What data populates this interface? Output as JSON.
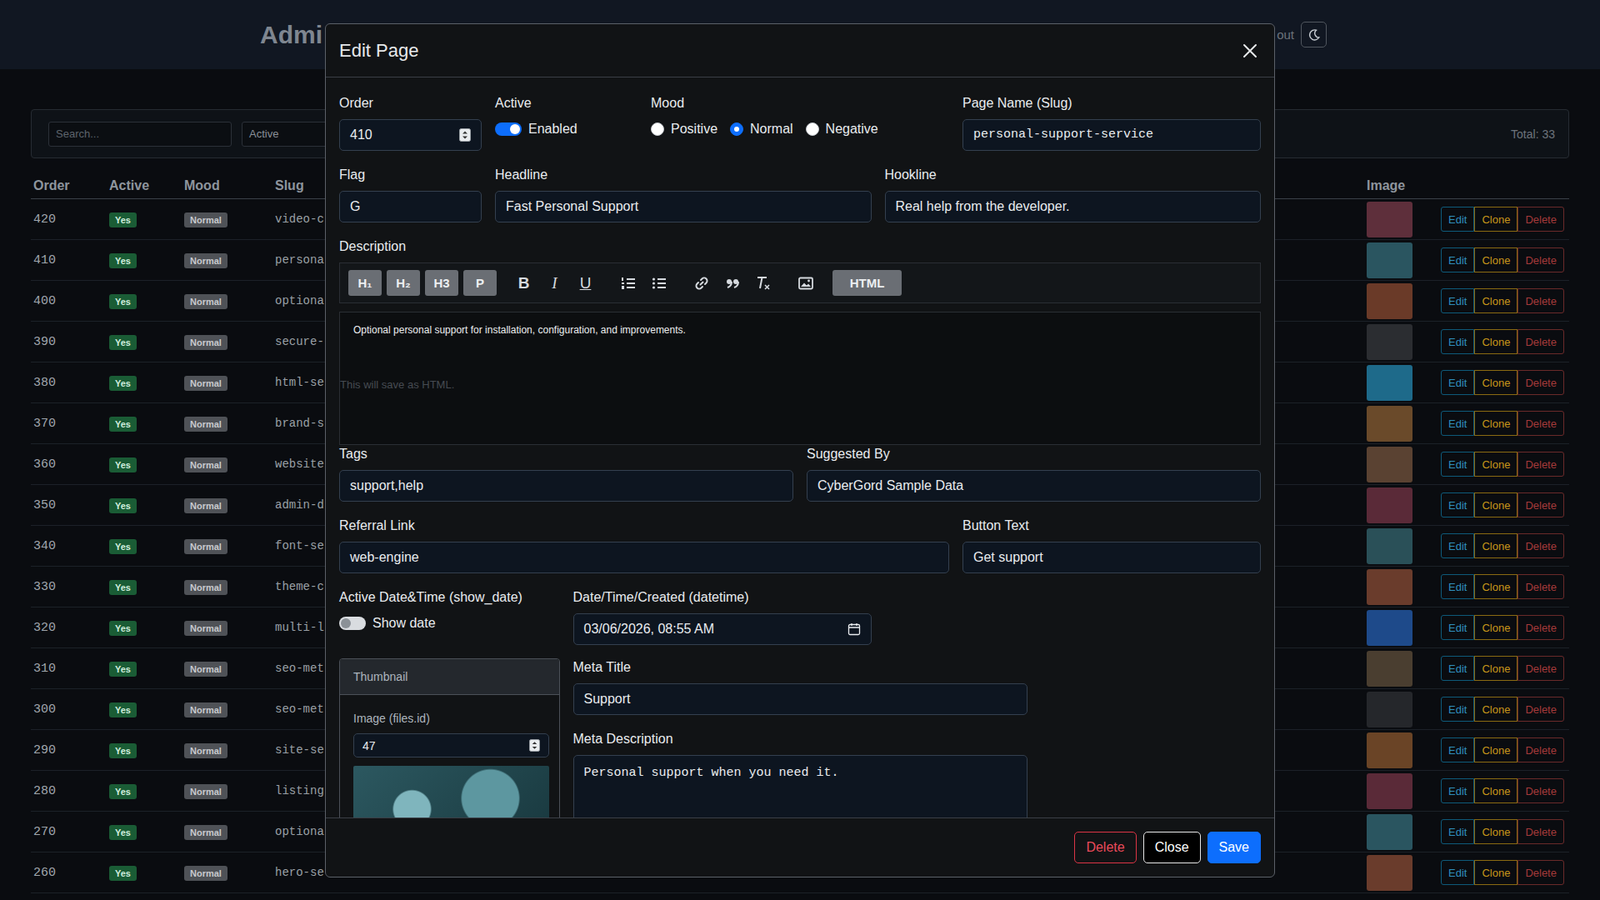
{
  "page": {
    "title": "Admi",
    "logout": "out"
  },
  "filters": {
    "search_placeholder": "Search...",
    "status": "Active",
    "total": "Total: 33"
  },
  "table": {
    "columns": [
      "Order",
      "Active",
      "Mood",
      "Slug",
      "Image"
    ],
    "row_actions": [
      {
        "label": "Edit",
        "kind": "info"
      },
      {
        "label": "Clone",
        "kind": "warning"
      },
      {
        "label": "Delete",
        "kind": "danger"
      }
    ],
    "rows": [
      {
        "order": "420",
        "active": "Yes",
        "mood": "Normal",
        "slug": "video-c",
        "color": "#5e2f3b"
      },
      {
        "order": "410",
        "active": "Yes",
        "mood": "Normal",
        "slug": "persona",
        "color": "#2a5560"
      },
      {
        "order": "400",
        "active": "Yes",
        "mood": "Normal",
        "slug": "optiona",
        "color": "#6a3a28"
      },
      {
        "order": "390",
        "active": "Yes",
        "mood": "Normal",
        "slug": "secure-",
        "color": "#2b2d31"
      },
      {
        "order": "380",
        "active": "Yes",
        "mood": "Normal",
        "slug": "html-se",
        "color": "#1e6a8a"
      },
      {
        "order": "370",
        "active": "Yes",
        "mood": "Normal",
        "slug": "brand-s",
        "color": "#6a4a2a"
      },
      {
        "order": "360",
        "active": "Yes",
        "mood": "Normal",
        "slug": "website",
        "color": "#5a4232"
      },
      {
        "order": "350",
        "active": "Yes",
        "mood": "Normal",
        "slug": "admin-d",
        "color": "#5a2a38"
      },
      {
        "order": "340",
        "active": "Yes",
        "mood": "Normal",
        "slug": "font-se",
        "color": "#2a5058"
      },
      {
        "order": "330",
        "active": "Yes",
        "mood": "Normal",
        "slug": "theme-c",
        "color": "#6a3c2c"
      },
      {
        "order": "320",
        "active": "Yes",
        "mood": "Normal",
        "slug": "multi-l",
        "color": "#1e4a8a"
      },
      {
        "order": "310",
        "active": "Yes",
        "mood": "Normal",
        "slug": "seo-met",
        "color": "#4a3e30"
      },
      {
        "order": "300",
        "active": "Yes",
        "mood": "Normal",
        "slug": "seo-met",
        "color": "#25272b"
      },
      {
        "order": "290",
        "active": "Yes",
        "mood": "Normal",
        "slug": "site-se",
        "color": "#6a4426"
      },
      {
        "order": "280",
        "active": "Yes",
        "mood": "Normal",
        "slug": "listing",
        "color": "#5a2a38"
      },
      {
        "order": "270",
        "active": "Yes",
        "mood": "Normal",
        "slug": "optiona",
        "color": "#2a5560"
      },
      {
        "order": "260",
        "active": "Yes",
        "mood": "Normal",
        "slug": "hero-se",
        "color": "#6a3c2c"
      }
    ]
  },
  "modal": {
    "title": "Edit Page",
    "order": {
      "label": "Order",
      "value": "410"
    },
    "active": {
      "label": "Active",
      "text": "Enabled",
      "on": true
    },
    "mood": {
      "label": "Mood",
      "options": [
        {
          "label": "Positive",
          "selected": false
        },
        {
          "label": "Normal",
          "selected": true
        },
        {
          "label": "Negative",
          "selected": false
        }
      ]
    },
    "slug": {
      "label": "Page Name (Slug)",
      "value": "personal-support-service"
    },
    "flag": {
      "label": "Flag",
      "value": "G"
    },
    "headline": {
      "label": "Headline",
      "value": "Fast Personal Support"
    },
    "hookline": {
      "label": "Hookline",
      "value": "Real help from the developer."
    },
    "description": {
      "label": "Description",
      "blocks": [
        "H₁",
        "H₂",
        "H3",
        "P"
      ],
      "formats": [
        {
          "label": "B",
          "kind": "bold"
        },
        {
          "label": "I",
          "kind": "italic"
        },
        {
          "label": "U",
          "kind": "underline"
        }
      ],
      "html": "HTML",
      "content": "Optional personal support for installation, configuration, and improvements.",
      "help": "This will save as HTML."
    },
    "tags": {
      "label": "Tags",
      "value": "support,help"
    },
    "suggested_by": {
      "label": "Suggested By",
      "value": "CyberGord Sample Data"
    },
    "referral_link": {
      "label": "Referral Link",
      "value": "web-engine"
    },
    "button_text": {
      "label": "Button Text",
      "value": "Get support"
    },
    "show_date": {
      "label": "Active Date&Time (show_date)",
      "text": "Show date",
      "on": false
    },
    "datetime": {
      "label": "Date/Time/Created (datetime)",
      "value": "03/06/2026, 08:55 AM"
    },
    "thumbnail": {
      "title": "Thumbnail",
      "label": "Image (files.id)",
      "value": "47"
    },
    "meta_title": {
      "label": "Meta Title",
      "value": "Support"
    },
    "meta_description": {
      "label": "Meta Description",
      "value": "Personal support when you need it."
    },
    "buttons": [
      {
        "label": "Delete",
        "kind": "danger"
      },
      {
        "label": "Close",
        "kind": "secondary"
      },
      {
        "label": "Save",
        "kind": "primary"
      }
    ]
  }
}
